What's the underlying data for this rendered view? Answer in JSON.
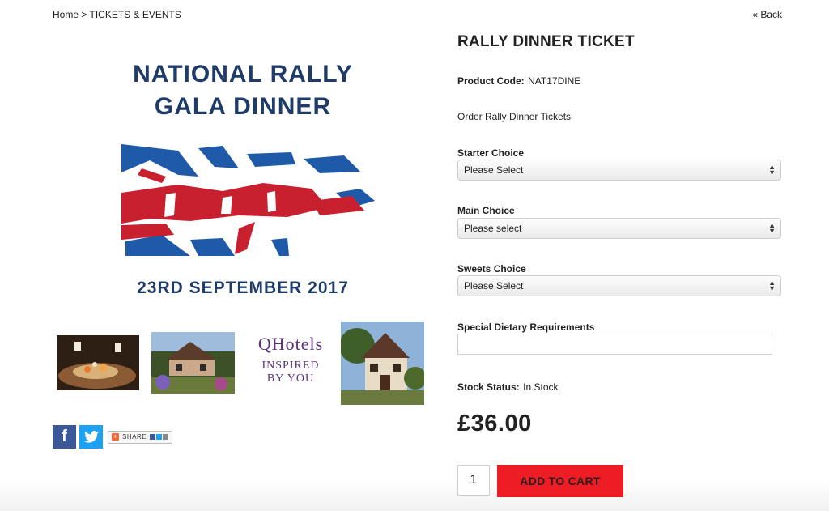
{
  "breadcrumb": {
    "home": "Home",
    "separator": ">",
    "current": "TICKETS & EVENTS"
  },
  "back_link": "« Back",
  "hero": {
    "title_line1": "NATIONAL RALLY",
    "title_line2": "GALA DINNER",
    "date": "23RD SEPTEMBER 2017",
    "flag_colors": {
      "blue": "#1e5aa8",
      "red": "#c8202f"
    }
  },
  "thumbnails": [
    {
      "name": "dinner-table-photo"
    },
    {
      "name": "hotel-garden-photo"
    },
    {
      "name": "qhotels-logo",
      "logo": "QHotels",
      "tagline_line1": "INSPIRED",
      "tagline_line2": "BY YOU"
    },
    {
      "name": "hotel-exterior-photo"
    }
  ],
  "social": {
    "facebook_icon": "f",
    "twitter_icon": "t",
    "share_label": "SHARE"
  },
  "product": {
    "title": "RALLY DINNER TICKET",
    "code_label": "Product Code:",
    "code_value": "NAT17DINE",
    "description": "Order Rally Dinner Tickets",
    "starter_label": "Starter Choice",
    "starter_value": "Please Select",
    "main_label": "Main Choice",
    "main_value": "Please select",
    "sweets_label": "Sweets Choice",
    "sweets_value": "Please Select",
    "dietary_label": "Special Dietary Requirements",
    "dietary_value": "",
    "stock_label": "Stock Status:",
    "stock_value": "In Stock",
    "price": "£36.00",
    "quantity": "1",
    "add_to_cart": "ADD TO CART"
  },
  "colors": {
    "accent": "#ee1d24",
    "hero_text": "#1f3c68",
    "facebook": "#3b5998",
    "twitter": "#1da1f2"
  }
}
